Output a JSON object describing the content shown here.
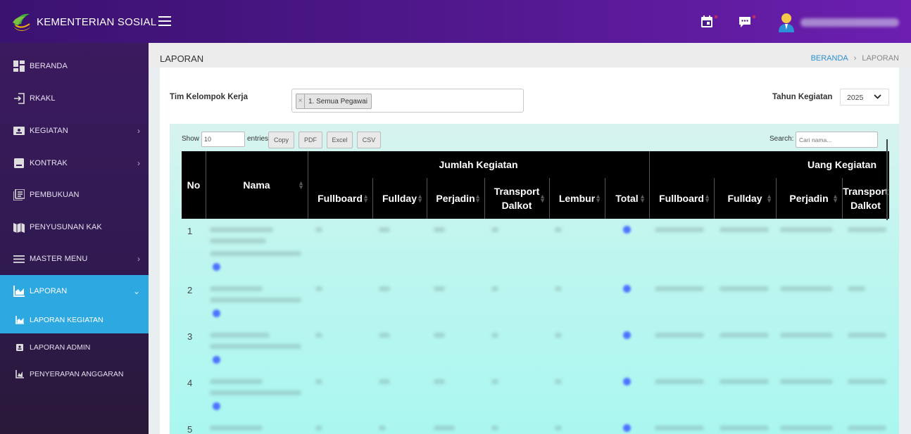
{
  "app": {
    "title": "KEMENTERIAN SOSIAL"
  },
  "header": {
    "icons": [
      "calendar-icon",
      "chat-icon",
      "user-avatar-icon"
    ]
  },
  "sidebar": {
    "items": [
      {
        "label": "BERANDA",
        "icon": "dashboard-icon"
      },
      {
        "label": "RKAKL",
        "icon": "login-icon"
      },
      {
        "label": "KEGIATAN",
        "icon": "id-card-icon"
      },
      {
        "label": "KONTRAK",
        "icon": "document-icon"
      },
      {
        "label": "PEMBUKUAN",
        "icon": "ledger-icon"
      },
      {
        "label": "PENYUSUNAN KAK",
        "icon": "map-icon"
      },
      {
        "label": "MASTER MENU",
        "icon": "menu-icon"
      },
      {
        "label": "LAPORAN",
        "icon": "chart-icon"
      }
    ],
    "sub_items": [
      {
        "label": "LAPORAN KEGIATAN",
        "icon": "chart-icon"
      },
      {
        "label": "LAPORAN ADMIN",
        "icon": "badge-icon"
      },
      {
        "label": "PENYERAPAN ANGGARAN",
        "icon": "line-chart-icon"
      }
    ]
  },
  "page": {
    "title": "LAPORAN",
    "breadcrumb": {
      "home": "BERANDA",
      "current": "LAPORAN"
    }
  },
  "filters": {
    "tim_label": "Tim Kelompok Kerja",
    "tim_chip": "1. Semua Pegawai",
    "tim_chip_remove": "×",
    "tahun_label": "Tahun Kegiatan",
    "tahun_value": "2025"
  },
  "datatable": {
    "show_label": "Show",
    "length_value": "10",
    "entries_label": "entries",
    "buttons": {
      "copy": "Copy",
      "pdf": "PDF",
      "excel": "Excel",
      "csv": "CSV"
    },
    "search_label": "Search:",
    "search_placeholder": "Cari nama..."
  },
  "table": {
    "col_no": "No",
    "col_nama": "Nama",
    "group_jumlah": "Jumlah Kegiatan",
    "group_uang": "Uang Kegiatan",
    "jumlah_cols": [
      "Fullboard",
      "Fullday",
      "Perjadin",
      "Transport Dalkot",
      "Lembur",
      "Total"
    ],
    "uang_cols": [
      "Fullboard",
      "Fullday",
      "Perjadin",
      "Transport Dalkot"
    ],
    "row_numbers": [
      "1",
      "2",
      "3",
      "4",
      "5"
    ]
  }
}
